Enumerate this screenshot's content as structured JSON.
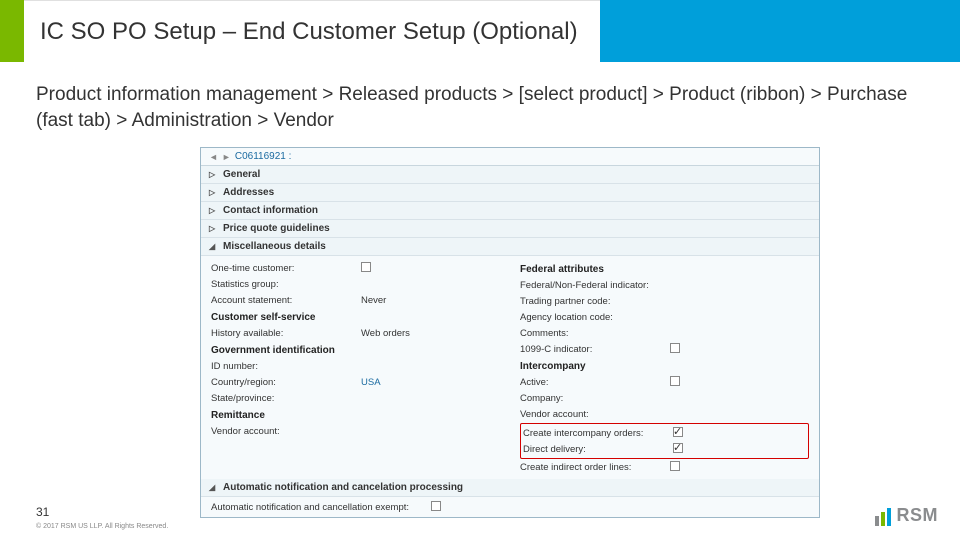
{
  "header": {
    "title": "IC SO PO Setup – End Customer Setup (Optional)"
  },
  "breadcrumb": "Product information management > Released products > [select product] > Product (ribbon) > Purchase (fast tab) > Administration > Vendor",
  "footer": {
    "page": "31",
    "copyright": "© 2017 RSM US LLP. All Rights Reserved."
  },
  "logo": {
    "text": "RSM"
  },
  "panel": {
    "crumb_id": "C06116921 :",
    "sections": {
      "general": "General",
      "addresses": "Addresses",
      "contact": "Contact information",
      "price": "Price quote guidelines",
      "misc": "Miscellaneous details",
      "auto": "Automatic notification and cancelation processing"
    },
    "left": {
      "one_time": {
        "label": "One-time customer:"
      },
      "stats_group": {
        "label": "Statistics group:"
      },
      "account_stmt": {
        "label": "Account statement:",
        "value": "Never"
      },
      "self_service_h": "Customer self-service",
      "history": {
        "label": "History available:",
        "value": "Web orders"
      },
      "gov_id_h": "Government identification",
      "id_number": {
        "label": "ID number:"
      },
      "country": {
        "label": "Country/region:",
        "value": "USA"
      },
      "state": {
        "label": "State/province:"
      },
      "remit_h": "Remittance",
      "vendor_acct": {
        "label": "Vendor account:"
      },
      "auto_exempt": {
        "label": "Automatic notification and cancellation exempt:"
      }
    },
    "right": {
      "fed_h": "Federal attributes",
      "fed_ind": {
        "label": "Federal/Non-Federal indicator:"
      },
      "trading": {
        "label": "Trading partner code:"
      },
      "agency": {
        "label": "Agency location code:"
      },
      "comments": {
        "label": "Comments:"
      },
      "c1099": {
        "label": "1099-C indicator:"
      },
      "inter_h": "Intercompany",
      "active": {
        "label": "Active:"
      },
      "company": {
        "label": "Company:"
      },
      "vendor": {
        "label": "Vendor account:"
      },
      "create_ic": {
        "label": "Create intercompany orders:"
      },
      "direct": {
        "label": "Direct delivery:"
      },
      "indirect": {
        "label": "Create indirect order lines:"
      }
    }
  }
}
